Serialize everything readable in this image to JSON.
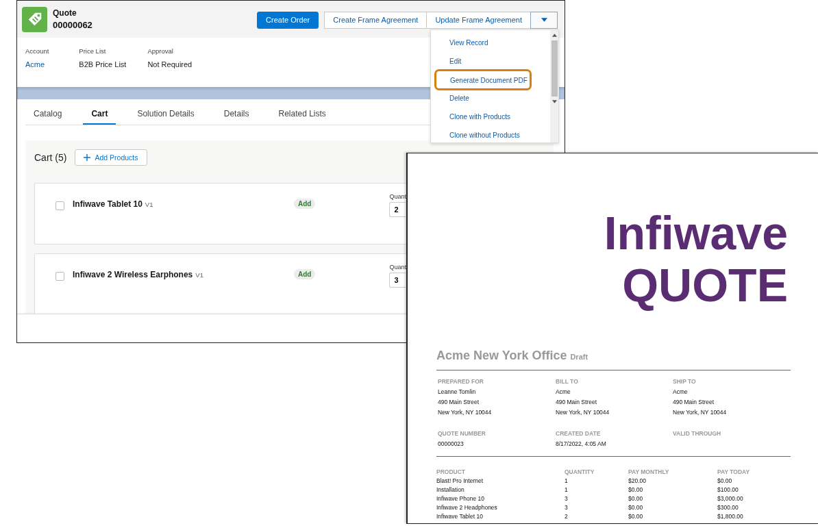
{
  "quote_window": {
    "record": {
      "object_type": "Quote",
      "number": "00000062"
    },
    "actions": [
      {
        "label": "Create Order",
        "kind": "primary"
      },
      {
        "label": "Create Frame Agreement",
        "kind": "neutral"
      },
      {
        "label": "Update Frame Agreement",
        "kind": "neutral"
      }
    ],
    "menu": [
      {
        "label": "View Record",
        "callout": false
      },
      {
        "label": "Edit",
        "callout": false
      },
      {
        "label": "Generate Document PDF",
        "callout": true
      },
      {
        "label": "Delete",
        "callout": false
      },
      {
        "label": "Clone with Products",
        "callout": false
      },
      {
        "label": "Clone without Products",
        "callout": false
      }
    ],
    "fields": [
      {
        "label": "Account",
        "value": "Acme",
        "link": true
      },
      {
        "label": "Price List",
        "value": "B2B Price List",
        "link": false
      },
      {
        "label": "Approval",
        "value": "Not Required",
        "link": false
      }
    ],
    "tabs": [
      {
        "label": "Catalog",
        "selected": false
      },
      {
        "label": "Cart",
        "selected": true
      },
      {
        "label": "Solution Details",
        "selected": false
      },
      {
        "label": "Details",
        "selected": false
      },
      {
        "label": "Related Lists",
        "selected": false
      }
    ],
    "cart": {
      "title": "Cart (5)",
      "add_button": "Add Products",
      "items": [
        {
          "name": "Infiwave Tablet 10",
          "version": "V1",
          "badge": "Add",
          "checked": false,
          "quantity_label": "Quant",
          "quantity": "2"
        },
        {
          "name": "Infiwave 2 Wireless Earphones",
          "version": "V1",
          "badge": "Add",
          "checked": false,
          "quantity_label": "Quant",
          "quantity": "3"
        }
      ]
    }
  },
  "pdf_window": {
    "brand": "Infiwave",
    "doc_title": "QUOTE",
    "heading": "Acme New York Office",
    "status": "Draft",
    "address_blocks": [
      {
        "label": "PREPARED FOR",
        "lines": [
          "Leanne Tomlin",
          "490 Main Street",
          "New York, NY 10044"
        ]
      },
      {
        "label": "BILL TO",
        "lines": [
          "Acme",
          "490 Main Street",
          "New York, NY 10044"
        ]
      },
      {
        "label": "SHIP TO",
        "lines": [
          "Acme",
          "490 Main Street",
          "New York, NY 10044"
        ]
      }
    ],
    "info_blocks": [
      {
        "label": "QUOTE NUMBER",
        "value": "00000023"
      },
      {
        "label": "CREATED DATE",
        "value": "8/17/2022, 4:05 AM"
      },
      {
        "label": "VALID THROUGH"
      }
    ],
    "table": {
      "columns": [
        "PRODUCT",
        "QUANTITY",
        "PAY MONTHLY",
        "PAY TODAY"
      ],
      "rows": [
        [
          "Blast! Pro Internet",
          "1",
          "$20.00",
          "$0.00"
        ],
        [
          "Installation",
          "1",
          "$0.00",
          "$100.00"
        ],
        [
          "Infiwave Phone 10",
          "3",
          "$0.00",
          "$3,000.00"
        ],
        [
          "Infiwave 2 Headphones",
          "3",
          "$0.00",
          "$300.00"
        ],
        [
          "Infiwave Tablet 10",
          "2",
          "$0.00",
          "$1,800.00"
        ]
      ]
    }
  }
}
